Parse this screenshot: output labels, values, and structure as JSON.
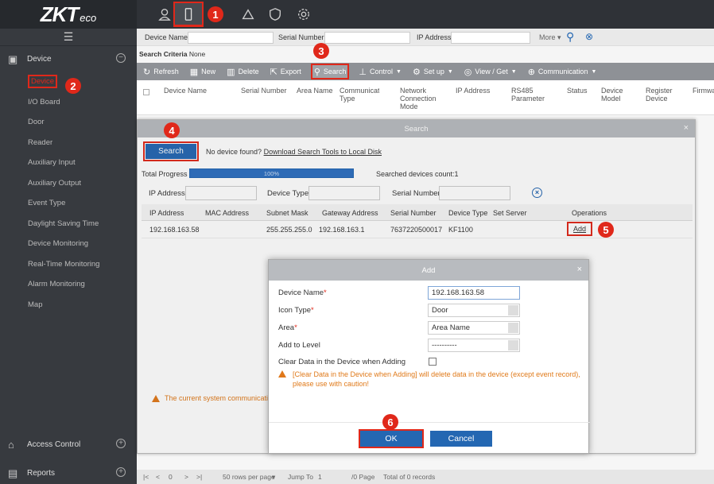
{
  "app": {
    "logo": "ZKT",
    "logo_suffix": "eco"
  },
  "badges": [
    "1",
    "2",
    "3",
    "4",
    "5",
    "6"
  ],
  "sidebar": {
    "group_device": "Device",
    "items": [
      "Device",
      "I/O Board",
      "Door",
      "Reader",
      "Auxiliary Input",
      "Auxiliary Output",
      "Event Type",
      "Daylight Saving Time",
      "Device Monitoring",
      "Real-Time Monitoring",
      "Alarm Monitoring",
      "Map"
    ],
    "group_access": "Access Control",
    "group_reports": "Reports"
  },
  "filter": {
    "device_name": "Device Name",
    "serial_number": "Serial Number",
    "ip_address": "IP Address",
    "more": "More"
  },
  "criteria": {
    "label": "Search Criteria",
    "value": "None"
  },
  "toolbar": {
    "refresh": "Refresh",
    "new": "New",
    "delete": "Delete",
    "export": "Export",
    "search": "Search",
    "control": "Control",
    "setup": "Set up",
    "view_get": "View / Get",
    "communication": "Communication"
  },
  "table_headers": [
    "Device Name",
    "Serial Number",
    "Area Name",
    "Communication Type",
    "Network Connection Mode",
    "IP Address",
    "RS485 Parameter",
    "Status",
    "Device Model",
    "Register Device",
    "Firmwa"
  ],
  "pager": {
    "first": "|<",
    "prev": "<",
    "page": "0",
    "next": ">",
    "last": ">|",
    "rows": "50 rows per page",
    "jump": "Jump To",
    "page_input": "1",
    "pages": "/0 Page",
    "total": "Total of 0 records"
  },
  "search_dialog": {
    "title": "Search",
    "search_button": "Search",
    "no_device": "No device found?",
    "download_link": "Download Search Tools to Local Disk",
    "progress_label": "Total Progress",
    "progress_text": "100%",
    "progress_value": 100,
    "count": "Searched devices count:1",
    "ip_label": "IP Address",
    "type_label": "Device Type",
    "serial_label": "Serial Number",
    "headers": [
      "IP Address",
      "MAC Address",
      "Subnet Mask",
      "Gateway Address",
      "Serial Number",
      "Device Type",
      "Set Server",
      "Operations"
    ],
    "row": {
      "ip": "192.168.163.58",
      "mac": "",
      "mask": "255.255.255.0",
      "gateway": "192.168.163.1",
      "serial": "7637220500017",
      "type": "KF1100",
      "server": "",
      "op": "Add"
    },
    "warning": "The current system communication"
  },
  "add_dialog": {
    "title": "Add",
    "device_name_label": "Device Name",
    "device_name_value": "192.168.163.58",
    "icon_type_label": "Icon Type",
    "icon_type_value": "Door",
    "area_label": "Area",
    "area_value": "Area Name",
    "level_label": "Add to Level",
    "level_value": "----------",
    "clear_label": "Clear Data in the Device when Adding",
    "warning": "[Clear Data in the Device when Adding] will delete data in the device (except event record), please use with caution!",
    "ok": "OK",
    "cancel": "Cancel"
  },
  "colors": {
    "accent_red": "#e0281a",
    "primary_blue": "#2467b2",
    "sidebar_bg": "#373a3f"
  }
}
